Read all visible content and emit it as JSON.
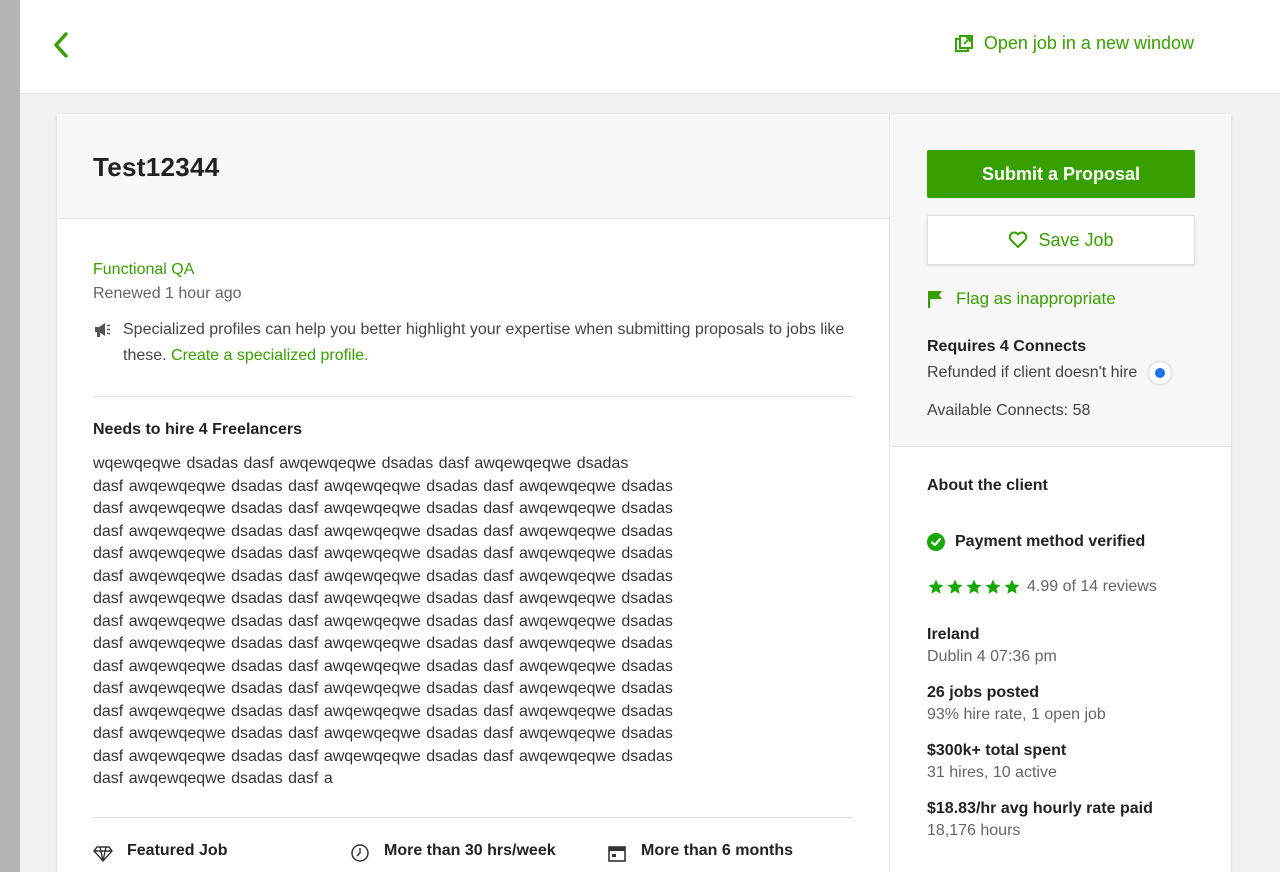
{
  "header": {
    "open_link": "Open job in a new window"
  },
  "job": {
    "title": "Test12344",
    "category": "Functional QA",
    "renewed": "Renewed 1 hour ago",
    "tip_text": "Specialized profiles can help you better highlight your expertise when submitting proposals to jobs like these.",
    "tip_link": "Create a specialized profile.",
    "hire_heading": "Needs to hire 4 Freelancers",
    "description": "wqewqeqwe dsadas dasf  awqewqeqwe dsadas dasf  awqewqeqwe dsadas\ndasf  awqewqeqwe dsadas dasf  awqewqeqwe dsadas dasf  awqewqeqwe dsadas\ndasf  awqewqeqwe dsadas dasf  awqewqeqwe dsadas dasf  awqewqeqwe dsadas\ndasf  awqewqeqwe dsadas dasf  awqewqeqwe dsadas dasf  awqewqeqwe dsadas\ndasf  awqewqeqwe dsadas dasf  awqewqeqwe dsadas dasf  awqewqeqwe dsadas\ndasf  awqewqeqwe dsadas dasf  awqewqeqwe dsadas dasf  awqewqeqwe dsadas\ndasf  awqewqeqwe dsadas dasf  awqewqeqwe dsadas dasf  awqewqeqwe dsadas\ndasf  awqewqeqwe dsadas dasf  awqewqeqwe dsadas dasf  awqewqeqwe dsadas\ndasf  awqewqeqwe dsadas dasf  awqewqeqwe dsadas dasf  awqewqeqwe dsadas\ndasf  awqewqeqwe dsadas dasf  awqewqeqwe dsadas dasf  awqewqeqwe dsadas\ndasf  awqewqeqwe dsadas dasf  awqewqeqwe dsadas dasf  awqewqeqwe dsadas\ndasf  awqewqeqwe dsadas dasf  awqewqeqwe dsadas dasf  awqewqeqwe dsadas\ndasf  awqewqeqwe dsadas dasf  awqewqeqwe dsadas dasf  awqewqeqwe dsadas\ndasf  awqewqeqwe dsadas dasf  awqewqeqwe dsadas dasf  awqewqeqwe dsadas\ndasf  awqewqeqwe dsadas dasf  a",
    "features": [
      {
        "icon": "diamond-icon",
        "label": "Featured Job"
      },
      {
        "icon": "clock-icon",
        "label": "More than 30 hrs/week"
      },
      {
        "icon": "calendar-icon",
        "label": "More than 6 months"
      }
    ]
  },
  "actions": {
    "submit": "Submit a Proposal",
    "save": "Save Job",
    "flag": "Flag as inappropriate",
    "connects_required": "Requires 4 Connects",
    "refund_note": "Refunded if client doesn't hire",
    "available_connects": "Available Connects: 58"
  },
  "client": {
    "heading": "About the client",
    "payment": "Payment method verified",
    "rating_text": "4.99 of 14 reviews",
    "rating_stars": 5,
    "country": "Ireland",
    "local_time": "Dublin 4 07:36 pm",
    "jobs_posted": "26 jobs posted",
    "hire_rate": "93% hire rate, 1 open job",
    "total_spent": "$300k+ total spent",
    "hires": "31 hires, 10 active",
    "avg_rate": "$18.83/hr avg hourly rate paid",
    "hours": "18,176 hours"
  },
  "colors": {
    "accent": "#37a000",
    "info_dot": "#1a73e8",
    "verified": "#14a800"
  }
}
